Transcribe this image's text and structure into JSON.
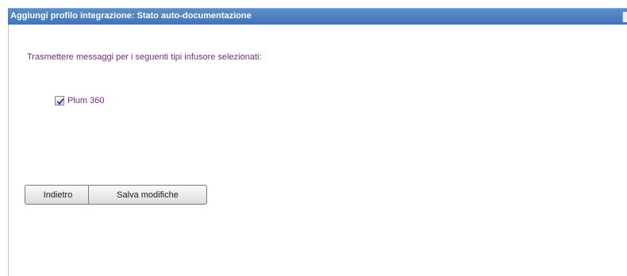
{
  "dialog": {
    "title": "Aggiungi profilo integrazione: Stato auto-documentazione",
    "close_icon": "close-icon"
  },
  "content": {
    "prompt": "Trasmettere messaggi per i seguenti tipi infusore selezionati:",
    "infuser_types": [
      {
        "label": "Plum 360",
        "checked": true
      }
    ]
  },
  "buttons": {
    "back_label": "Indietro",
    "save_label": "Salva modifiche"
  },
  "colors": {
    "titlebar": "#4a80c2",
    "text_accent": "#7a2a7a"
  }
}
